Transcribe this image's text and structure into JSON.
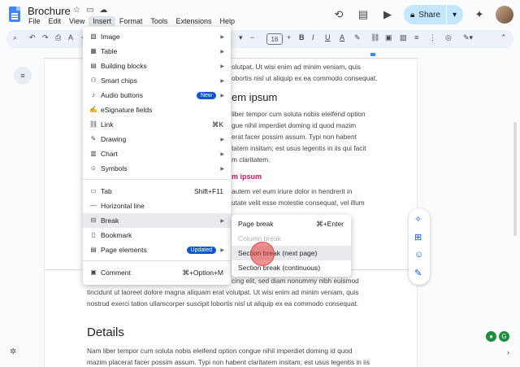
{
  "app": {
    "title": "Brochure",
    "menus": [
      "File",
      "Edit",
      "View",
      "Insert",
      "Format",
      "Tools",
      "Extensions",
      "Help"
    ],
    "active_menu": "Insert",
    "share_label": "Share",
    "accent_color": "#c2e7ff"
  },
  "toolbar": {
    "font_size": "16"
  },
  "insert_menu": {
    "items": [
      {
        "label": "Image",
        "icon": "image-icon",
        "submenu": true
      },
      {
        "label": "Table",
        "icon": "table-icon",
        "submenu": true
      },
      {
        "label": "Building blocks",
        "icon": "building-blocks-icon",
        "submenu": true
      },
      {
        "label": "Smart chips",
        "icon": "smart-chips-icon",
        "submenu": true
      },
      {
        "label": "Audio buttons",
        "icon": "audio-icon",
        "badge": "New",
        "submenu": true
      },
      {
        "label": "eSignature fields",
        "icon": "signature-icon"
      },
      {
        "label": "Link",
        "icon": "link-icon",
        "shortcut": "⌘K"
      },
      {
        "label": "Drawing",
        "icon": "drawing-icon",
        "submenu": true
      },
      {
        "label": "Chart",
        "icon": "chart-icon",
        "submenu": true
      },
      {
        "label": "Symbols",
        "icon": "symbols-icon",
        "submenu": true
      },
      {
        "label": "Tab",
        "icon": "tab-icon",
        "shortcut": "Shift+F11"
      },
      {
        "label": "Horizontal line",
        "icon": "horizontal-line-icon"
      },
      {
        "label": "Break",
        "icon": "break-icon",
        "submenu": true,
        "highlighted": true
      },
      {
        "label": "Bookmark",
        "icon": "bookmark-icon"
      },
      {
        "label": "Page elements",
        "icon": "page-elements-icon",
        "badge": "Updated",
        "submenu": true
      },
      {
        "label": "Comment",
        "icon": "comment-icon",
        "shortcut": "⌘+Option+M"
      }
    ]
  },
  "break_submenu": {
    "items": [
      {
        "label": "Page break",
        "shortcut": "⌘+Enter"
      },
      {
        "label": "Column break",
        "disabled": true
      },
      {
        "label": "Section break (next page)",
        "highlighted": true
      },
      {
        "label": "Section break (continuous)"
      }
    ]
  },
  "document": {
    "lines_top": [
      "olutpat. Ut wisi enim ad minim veniam, quis",
      "obortis nisl ut aliquip ex ea commodo consequat."
    ],
    "heading1": "em ipsum",
    "para1": [
      "liber tempor cum soluta nobis eleifend option",
      "gue nihil imperdiet doming id quod mazim",
      "erat facer possim assum. Typi non habent",
      "tatem insitam; est usus legentis in iis qui facit",
      "m claritatem."
    ],
    "subheading": "m ipsum",
    "para2": [
      "autem vel eum iriure dolor in hendrerit in",
      "utate velit esse molestie consequat, vel illum"
    ],
    "para3": [
      "cing elit, sed diam nonummy nibh euismod",
      "tincidunt ut laoreet dolore magna aliquam erat volutpat. Ut wisi enim ad minim veniam, quis",
      "nostrud exerci tation ullamcorper suscipit lobortis nisl ut aliquip ex ea commodo consequat."
    ],
    "heading2": "Details",
    "para4": [
      "Nam liber tempor cum soluta nobis eleifend option congue nihil imperdiet doming id quod",
      "mazim placerat facer possim assum. Typi non habent claritatem insitam; est usus legentis in iis"
    ]
  }
}
